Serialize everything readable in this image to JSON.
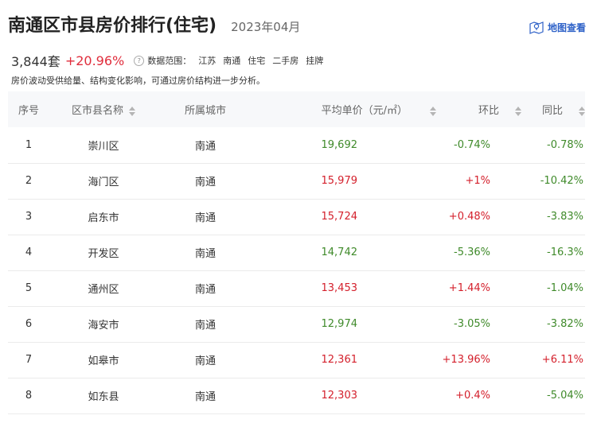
{
  "header": {
    "title": "南通区市县房价排行(住宅)",
    "date": "2023年04月",
    "map_link_label": "地图查看"
  },
  "summary": {
    "count": "3,844套",
    "change": "+20.96%",
    "scope_label": "数据范围：",
    "scope_items": [
      "江苏",
      "南通",
      "住宅",
      "二手房",
      "挂牌"
    ],
    "note": "房价波动受供给量、结构变化影响，可通过房价结构进一步分析。"
  },
  "table": {
    "columns": [
      "序号",
      "区市县名称",
      "所属城市",
      "平均单价（元/㎡）",
      "环比",
      "同比"
    ],
    "rows": [
      {
        "rank": "1",
        "name": "崇川区",
        "city": "南通",
        "price": "19,692",
        "mom": "-0.74%",
        "yoy": "-0.78%",
        "price_trend": "down",
        "mom_trend": "down",
        "yoy_trend": "down"
      },
      {
        "rank": "2",
        "name": "海门区",
        "city": "南通",
        "price": "15,979",
        "mom": "+1%",
        "yoy": "-10.42%",
        "price_trend": "up",
        "mom_trend": "up",
        "yoy_trend": "down"
      },
      {
        "rank": "3",
        "name": "启东市",
        "city": "南通",
        "price": "15,724",
        "mom": "+0.48%",
        "yoy": "-3.83%",
        "price_trend": "up",
        "mom_trend": "up",
        "yoy_trend": "down"
      },
      {
        "rank": "4",
        "name": "开发区",
        "city": "南通",
        "price": "14,742",
        "mom": "-5.36%",
        "yoy": "-16.3%",
        "price_trend": "down",
        "mom_trend": "down",
        "yoy_trend": "down"
      },
      {
        "rank": "5",
        "name": "通州区",
        "city": "南通",
        "price": "13,453",
        "mom": "+1.44%",
        "yoy": "-1.04%",
        "price_trend": "up",
        "mom_trend": "up",
        "yoy_trend": "down"
      },
      {
        "rank": "6",
        "name": "海安市",
        "city": "南通",
        "price": "12,974",
        "mom": "-3.05%",
        "yoy": "-3.82%",
        "price_trend": "down",
        "mom_trend": "down",
        "yoy_trend": "down"
      },
      {
        "rank": "7",
        "name": "如皋市",
        "city": "南通",
        "price": "12,361",
        "mom": "+13.96%",
        "yoy": "+6.11%",
        "price_trend": "up",
        "mom_trend": "up",
        "yoy_trend": "up"
      },
      {
        "rank": "8",
        "name": "如东县",
        "city": "南通",
        "price": "12,303",
        "mom": "+0.4%",
        "yoy": "-5.04%",
        "price_trend": "up",
        "mom_trend": "up",
        "yoy_trend": "down"
      }
    ]
  },
  "colors": {
    "up": "#d4202c",
    "down": "#3f8a2a",
    "link": "#2f62c8"
  }
}
